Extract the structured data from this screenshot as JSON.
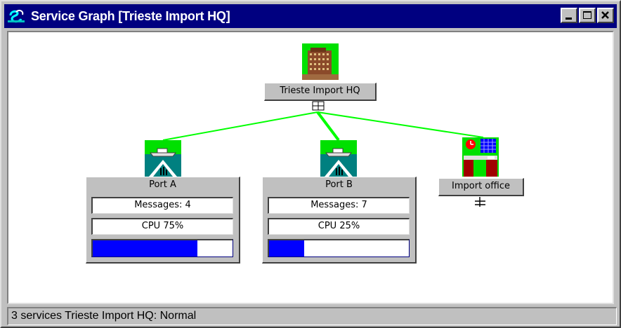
{
  "window": {
    "title": "Service Graph [Trieste Import HQ]",
    "icon": "service-graph-app-icon",
    "controls": [
      "minimize",
      "maximize",
      "close"
    ]
  },
  "colors": {
    "titlebar": "#000080",
    "edge": "#00ff00",
    "bar_fill": "#0000ff",
    "canvas": "#ffffff",
    "chrome": "#c0c0c0"
  },
  "nodes": {
    "hq": {
      "label": "Trieste Import HQ",
      "icon": "office-building-icon"
    },
    "port_a": {
      "label": "Port A",
      "icon": "port-ship-icon",
      "messages": "Messages: 4",
      "cpu": "CPU 75%",
      "cpu_level": 0.75
    },
    "port_b": {
      "label": "Port B",
      "icon": "port-ship-icon",
      "messages": "Messages: 7",
      "cpu": "CPU 25%",
      "cpu_level": 0.25
    },
    "import_office": {
      "label": "Import office",
      "icon": "office-desk-icon"
    }
  },
  "status": "3 services  Trieste Import HQ: Normal"
}
